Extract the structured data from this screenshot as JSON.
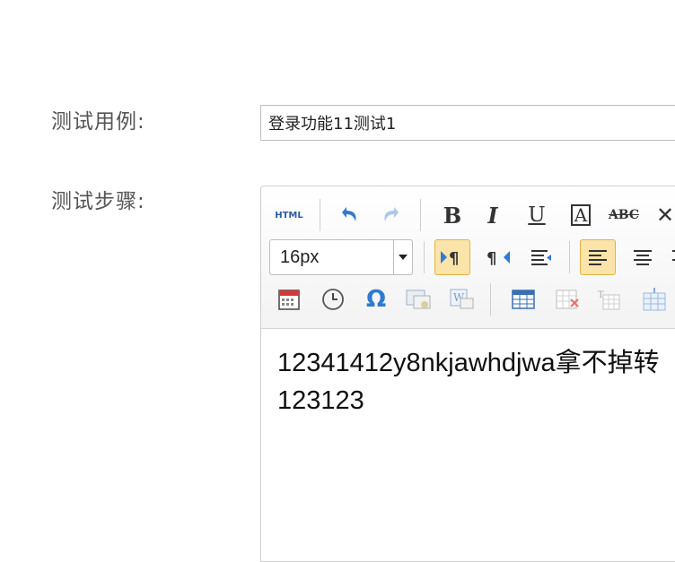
{
  "form": {
    "case_label": "测试用例:",
    "case_value": "登录功能11测试1",
    "steps_label": "测试步骤:"
  },
  "toolbar": {
    "html_label": "HTML",
    "font_size": "16px",
    "active_color": "#fbe4a9",
    "icons": [
      "html-source",
      "undo",
      "redo",
      "bold",
      "italic",
      "underline",
      "font-border",
      "strikethrough",
      "remove-format",
      "ltr",
      "rtl",
      "indent",
      "align-left",
      "align-center",
      "align-right",
      "date",
      "time",
      "special-char",
      "image",
      "word-image",
      "insert-table",
      "delete-table",
      "table-title",
      "insert-row"
    ]
  },
  "editor": {
    "lines": [
      "12341412y8nkjawhdjwa拿不掉转",
      "123123"
    ]
  }
}
